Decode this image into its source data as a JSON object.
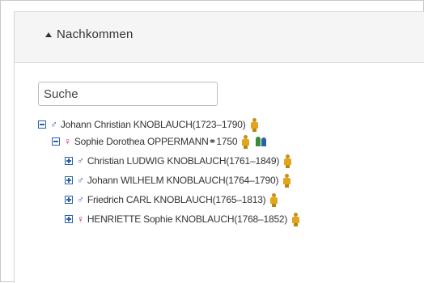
{
  "panel": {
    "title": "Nachkommen"
  },
  "search": {
    "placeholder": "Suche"
  },
  "tree": [
    {
      "sex_symbol": "♂",
      "label": "Johann Christian KNOBLAUCH(1723–1790)",
      "toggle": "minus",
      "icons": [
        "person-icon"
      ]
    },
    {
      "sex_symbol": "♀",
      "label": "Sophie Dorothea OPPERMANN⚭1750",
      "toggle": "minus",
      "icons": [
        "person-icon",
        "couple-icon"
      ]
    },
    {
      "sex_symbol": "♂",
      "label": "Christian LUDWIG KNOBLAUCH(1761–1849)",
      "toggle": "plus",
      "icons": [
        "person-icon"
      ]
    },
    {
      "sex_symbol": "♂",
      "label": "Johann WILHELM KNOBLAUCH(1764–1790)",
      "toggle": "plus",
      "icons": [
        "person-icon"
      ]
    },
    {
      "sex_symbol": "♂",
      "label": "Friedrich CARL KNOBLAUCH(1765–1813)",
      "toggle": "plus",
      "icons": [
        "person-icon"
      ]
    },
    {
      "sex_symbol": "♀",
      "label": "HENRIETTE Sophie KNOBLAUCH(1768–1852)",
      "toggle": "plus",
      "icons": [
        "person-icon"
      ]
    }
  ],
  "colors": {
    "toggle": "#2b62a8",
    "male": "#2b62a8",
    "female": "#c2185b",
    "person_icon": "#e2a51c"
  }
}
